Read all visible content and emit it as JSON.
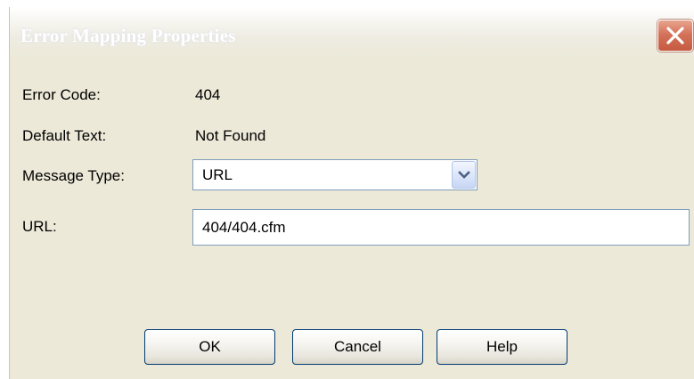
{
  "window": {
    "title": "Error Mapping Properties"
  },
  "fields": {
    "error_code_label": "Error Code:",
    "error_code_value": "404",
    "default_text_label": "Default Text:",
    "default_text_value": "Not Found",
    "message_type_label": "Message Type:",
    "message_type_selected": "URL",
    "url_label": "URL:",
    "url_value": "404/404.cfm"
  },
  "buttons": {
    "ok": "OK",
    "cancel": "Cancel",
    "help": "Help"
  },
  "icons": {
    "close": "close-icon",
    "dropdown": "chevron-down-icon"
  },
  "colors": {
    "dialog_background": "#ece9d8",
    "close_button": "#d4735a",
    "input_border": "#7f9db9",
    "button_border": "#003c74"
  }
}
